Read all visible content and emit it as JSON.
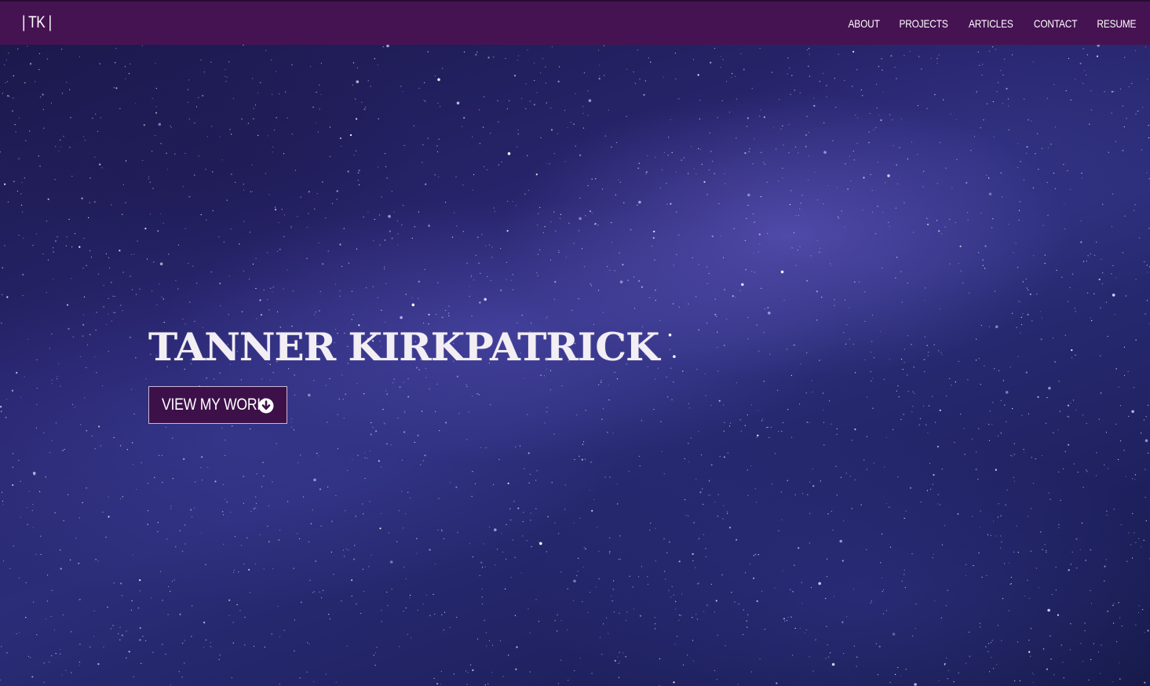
{
  "nav": {
    "brand": "| TK |",
    "links": [
      {
        "label": "ABOUT"
      },
      {
        "label": "PROJECTS"
      },
      {
        "label": "ARTICLES"
      },
      {
        "label": "CONTACT"
      },
      {
        "label": "RESUME"
      }
    ]
  },
  "hero": {
    "title": "TANNER KIRKPATRICK",
    "cta_label": "VIEW MY WORK",
    "cta_icon": "arrow-circle-down-icon",
    "background": "starry-night-sky-image"
  },
  "colors": {
    "nav_bg": "#461352",
    "button_bg": "#3d1049",
    "title_text": "#f3eef3"
  }
}
